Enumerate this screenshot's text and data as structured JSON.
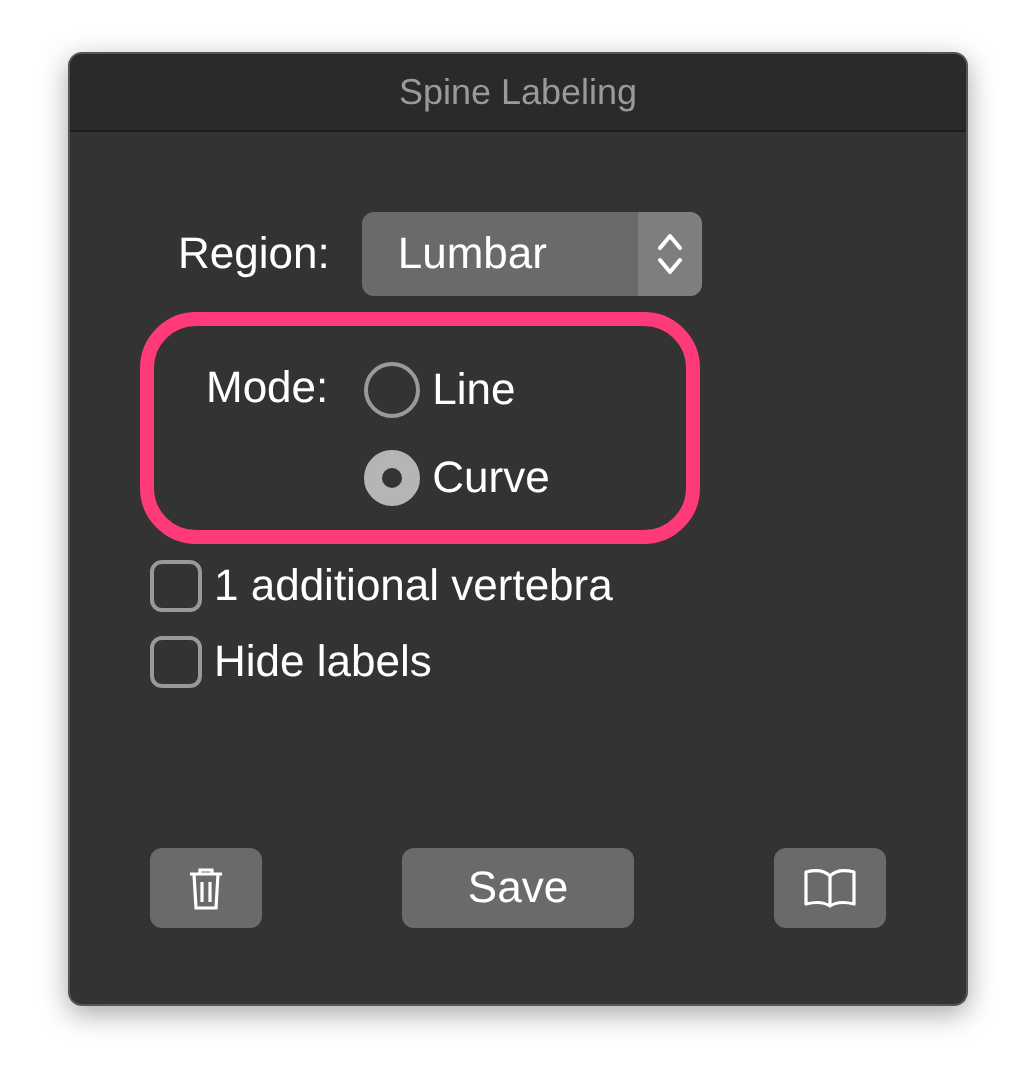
{
  "window": {
    "title": "Spine Labeling"
  },
  "region": {
    "label": "Region:",
    "value": "Lumbar"
  },
  "mode": {
    "label": "Mode:",
    "highlighted": true,
    "options": [
      {
        "label": "Line",
        "selected": false
      },
      {
        "label": "Curve",
        "selected": true
      }
    ]
  },
  "checkboxes": [
    {
      "label": "1 additional vertebra",
      "checked": false
    },
    {
      "label": "Hide labels",
      "checked": false
    }
  ],
  "buttons": [
    {
      "kind": "delete"
    },
    {
      "kind": "text",
      "label": "Save"
    },
    {
      "kind": "help"
    }
  ]
}
